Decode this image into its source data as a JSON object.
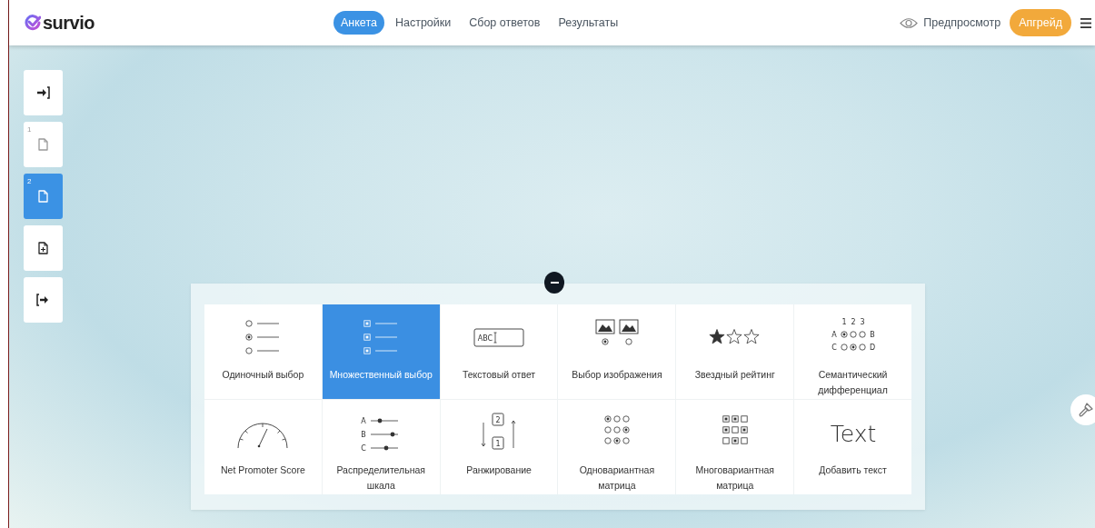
{
  "header": {
    "logo": "survio",
    "tabs": [
      {
        "label": "Анкета",
        "selected": true
      },
      {
        "label": "Настройки",
        "selected": false
      },
      {
        "label": "Сбор ответов",
        "selected": false
      },
      {
        "label": "Результаты",
        "selected": false
      }
    ],
    "preview": "Предпросмотр",
    "upgrade": "Апгрейд"
  },
  "sidebar": [
    {
      "kind": "intro",
      "selected": false
    },
    {
      "kind": "page",
      "number": "1",
      "selected": false
    },
    {
      "kind": "page",
      "number": "2",
      "selected": true
    },
    {
      "kind": "add-page",
      "selected": false
    },
    {
      "kind": "outro",
      "selected": false
    }
  ],
  "question_types": [
    {
      "kind": "single",
      "label": "Одиночный выбор",
      "selected": false
    },
    {
      "kind": "multiple",
      "label": "Множественный выбор",
      "selected": true
    },
    {
      "kind": "text",
      "label": "Текстовый ответ",
      "icon_text": [
        "ABC"
      ],
      "selected": false
    },
    {
      "kind": "image",
      "label": "Выбор изображения",
      "selected": false
    },
    {
      "kind": "stars",
      "label": "Звездный рейтинг",
      "selected": false
    },
    {
      "kind": "semantic",
      "label": "Семантический дифференциал",
      "icon_text": [
        "1",
        "2",
        "3",
        "A",
        "B",
        "C",
        "D"
      ],
      "selected": false
    },
    {
      "kind": "nps",
      "label": "Net Promoter Score",
      "selected": false
    },
    {
      "kind": "distribution",
      "label": "Распределительная шкала",
      "icon_text": [
        "A",
        "B",
        "C"
      ],
      "selected": false
    },
    {
      "kind": "ranking",
      "label": "Ранжирование",
      "icon_text": [
        "2",
        "1"
      ],
      "selected": false
    },
    {
      "kind": "single-matrix",
      "label": "Одновариантная матрица",
      "selected": false
    },
    {
      "kind": "multi-matrix",
      "label": "Многовариантная матрица",
      "selected": false
    },
    {
      "kind": "add-text",
      "label": "Добавить текст",
      "icon_text": [
        "Text"
      ],
      "selected": false
    }
  ]
}
